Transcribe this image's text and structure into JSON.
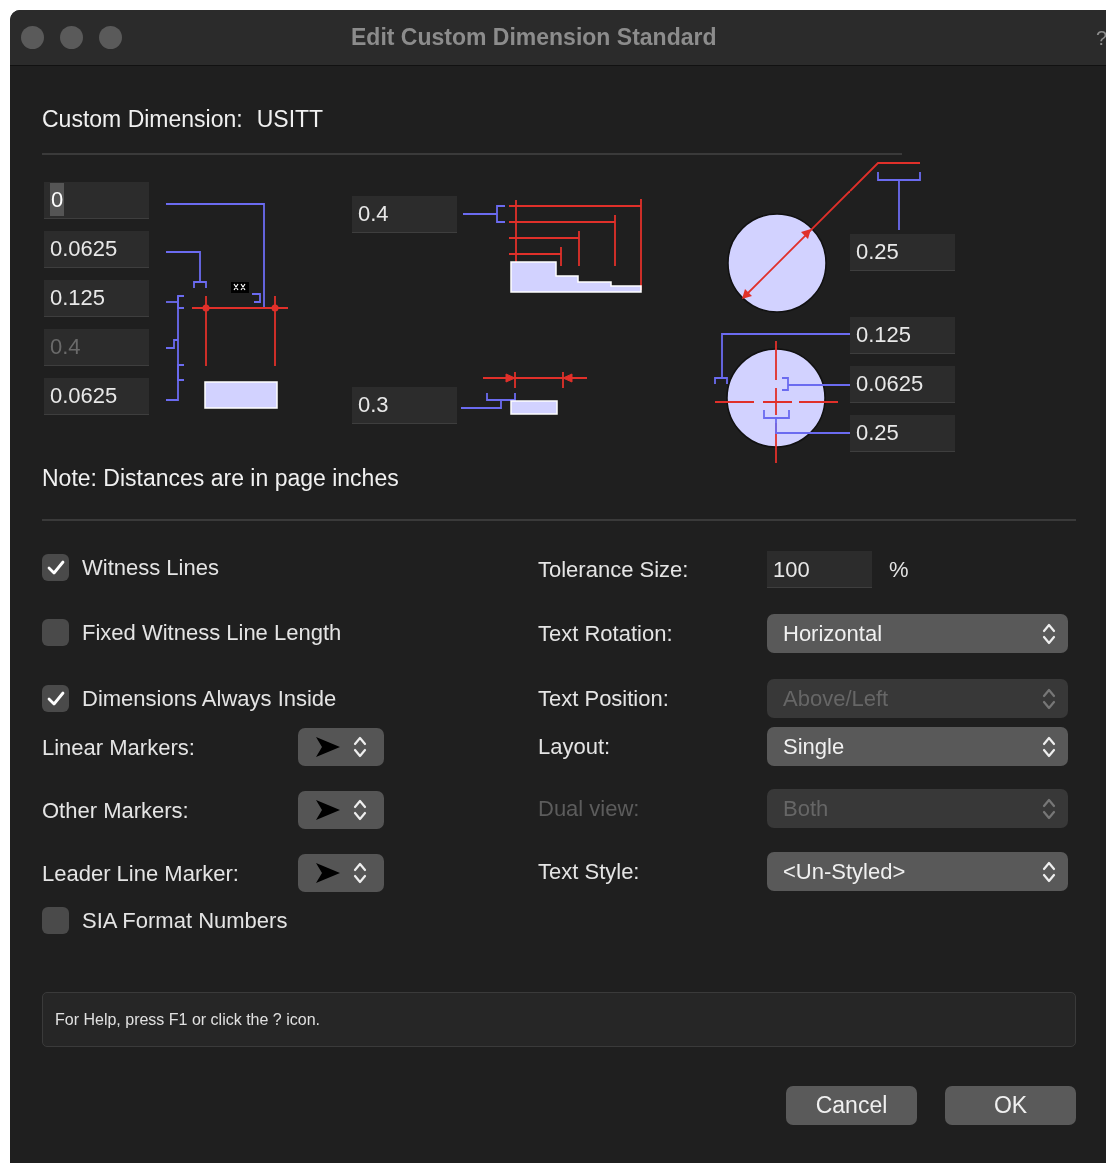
{
  "window": {
    "title": "Edit Custom Dimension Standard",
    "help_glyph": "?"
  },
  "custom_dimension": {
    "label": "Custom Dimension:",
    "value": "USITT"
  },
  "diagram": {
    "left_fields": [
      {
        "value": "0",
        "disabled": false,
        "text_selected": true
      },
      {
        "value": "0.0625",
        "disabled": false,
        "text_selected": false
      },
      {
        "value": "0.125",
        "disabled": false,
        "text_selected": false
      },
      {
        "value": "0.4",
        "disabled": true,
        "text_selected": false
      },
      {
        "value": "0.0625",
        "disabled": false,
        "text_selected": false
      }
    ],
    "middle_fields": [
      {
        "value": "0.4",
        "disabled": false,
        "text_selected": false
      },
      {
        "value": "0.3",
        "disabled": false,
        "text_selected": false
      }
    ],
    "right_fields": [
      {
        "value": "0.25",
        "disabled": false,
        "text_selected": false
      },
      {
        "value": "0.125",
        "disabled": false,
        "text_selected": false
      },
      {
        "value": "0.0625",
        "disabled": false,
        "text_selected": false
      },
      {
        "value": "0.25",
        "disabled": false,
        "text_selected": false
      }
    ]
  },
  "note": "Note: Distances are in page inches",
  "left_options": [
    {
      "kind": "checkbox",
      "label": "Witness Lines",
      "checked": true
    },
    {
      "kind": "checkbox",
      "label": "Fixed Witness Line Length",
      "checked": false
    },
    {
      "kind": "checkbox",
      "label": "Dimensions Always Inside",
      "checked": true
    },
    {
      "kind": "marker",
      "label": "Linear Markers:"
    },
    {
      "kind": "marker",
      "label": "Other Markers:"
    },
    {
      "kind": "marker",
      "label": "Leader Line Marker:"
    },
    {
      "kind": "checkbox",
      "label": "SIA Format Numbers",
      "checked": false
    }
  ],
  "right_options": [
    {
      "kind": "field",
      "label": "Tolerance Size:",
      "value": "100",
      "unit": "%",
      "disabled": false
    },
    {
      "kind": "select",
      "label": "Text Rotation:",
      "value": "Horizontal",
      "disabled": false
    },
    {
      "kind": "select",
      "label": "Text Position:",
      "value": "Above/Left",
      "disabled": true
    },
    {
      "kind": "select",
      "label": "Layout:",
      "value": "Single",
      "disabled": false
    },
    {
      "kind": "select",
      "label": "Dual view:",
      "value": "Both",
      "disabled": true,
      "label_disabled": true
    },
    {
      "kind": "select",
      "label": "Text Style:",
      "value": "<Un-Styled>",
      "disabled": false
    }
  ],
  "help_text": "For Help, press F1 or click the ? icon.",
  "buttons": [
    {
      "label": "Cancel"
    },
    {
      "label": "OK"
    }
  ]
}
